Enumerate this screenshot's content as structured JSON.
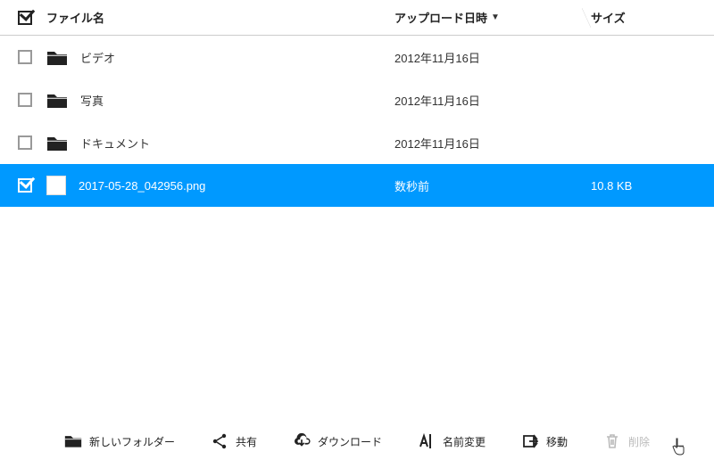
{
  "columns": {
    "name": "ファイル名",
    "upload": "アップロード日時",
    "size": "サイズ"
  },
  "rows": [
    {
      "name": "ビデオ",
      "upload": "2012年11月16日",
      "size": "",
      "type": "folder",
      "selected": false
    },
    {
      "name": "写真",
      "upload": "2012年11月16日",
      "size": "",
      "type": "folder",
      "selected": false
    },
    {
      "name": "ドキュメント",
      "upload": "2012年11月16日",
      "size": "",
      "type": "folder",
      "selected": false
    },
    {
      "name": "2017-05-28_042956.png",
      "upload": "数秒前",
      "size": "10.8 KB",
      "type": "file",
      "selected": true
    }
  ],
  "toolbar": {
    "newfolder": "新しいフォルダー",
    "share": "共有",
    "download": "ダウンロード",
    "rename": "名前変更",
    "move": "移動",
    "delete": "削除"
  }
}
